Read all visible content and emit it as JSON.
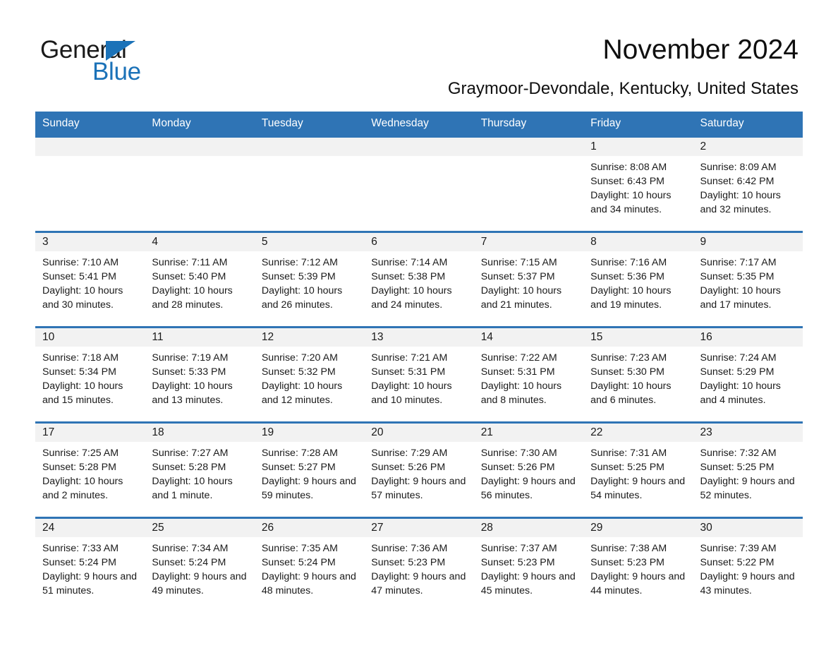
{
  "brand": {
    "name_part1": "General",
    "name_part2": "Blue",
    "colors": {
      "blue": "#1b72b8",
      "header_blue": "#2f74b5",
      "band_gray": "#f2f2f2"
    }
  },
  "header": {
    "title": "November 2024",
    "subtitle": "Graymoor-Devondale, Kentucky, United States"
  },
  "calendar": {
    "weekdays": [
      "Sunday",
      "Monday",
      "Tuesday",
      "Wednesday",
      "Thursday",
      "Friday",
      "Saturday"
    ],
    "weeks": [
      [
        {
          "day": "",
          "sunrise": "",
          "sunset": "",
          "daylight": ""
        },
        {
          "day": "",
          "sunrise": "",
          "sunset": "",
          "daylight": ""
        },
        {
          "day": "",
          "sunrise": "",
          "sunset": "",
          "daylight": ""
        },
        {
          "day": "",
          "sunrise": "",
          "sunset": "",
          "daylight": ""
        },
        {
          "day": "",
          "sunrise": "",
          "sunset": "",
          "daylight": ""
        },
        {
          "day": "1",
          "sunrise": "Sunrise: 8:08 AM",
          "sunset": "Sunset: 6:43 PM",
          "daylight": "Daylight: 10 hours and 34 minutes."
        },
        {
          "day": "2",
          "sunrise": "Sunrise: 8:09 AM",
          "sunset": "Sunset: 6:42 PM",
          "daylight": "Daylight: 10 hours and 32 minutes."
        }
      ],
      [
        {
          "day": "3",
          "sunrise": "Sunrise: 7:10 AM",
          "sunset": "Sunset: 5:41 PM",
          "daylight": "Daylight: 10 hours and 30 minutes."
        },
        {
          "day": "4",
          "sunrise": "Sunrise: 7:11 AM",
          "sunset": "Sunset: 5:40 PM",
          "daylight": "Daylight: 10 hours and 28 minutes."
        },
        {
          "day": "5",
          "sunrise": "Sunrise: 7:12 AM",
          "sunset": "Sunset: 5:39 PM",
          "daylight": "Daylight: 10 hours and 26 minutes."
        },
        {
          "day": "6",
          "sunrise": "Sunrise: 7:14 AM",
          "sunset": "Sunset: 5:38 PM",
          "daylight": "Daylight: 10 hours and 24 minutes."
        },
        {
          "day": "7",
          "sunrise": "Sunrise: 7:15 AM",
          "sunset": "Sunset: 5:37 PM",
          "daylight": "Daylight: 10 hours and 21 minutes."
        },
        {
          "day": "8",
          "sunrise": "Sunrise: 7:16 AM",
          "sunset": "Sunset: 5:36 PM",
          "daylight": "Daylight: 10 hours and 19 minutes."
        },
        {
          "day": "9",
          "sunrise": "Sunrise: 7:17 AM",
          "sunset": "Sunset: 5:35 PM",
          "daylight": "Daylight: 10 hours and 17 minutes."
        }
      ],
      [
        {
          "day": "10",
          "sunrise": "Sunrise: 7:18 AM",
          "sunset": "Sunset: 5:34 PM",
          "daylight": "Daylight: 10 hours and 15 minutes."
        },
        {
          "day": "11",
          "sunrise": "Sunrise: 7:19 AM",
          "sunset": "Sunset: 5:33 PM",
          "daylight": "Daylight: 10 hours and 13 minutes."
        },
        {
          "day": "12",
          "sunrise": "Sunrise: 7:20 AM",
          "sunset": "Sunset: 5:32 PM",
          "daylight": "Daylight: 10 hours and 12 minutes."
        },
        {
          "day": "13",
          "sunrise": "Sunrise: 7:21 AM",
          "sunset": "Sunset: 5:31 PM",
          "daylight": "Daylight: 10 hours and 10 minutes."
        },
        {
          "day": "14",
          "sunrise": "Sunrise: 7:22 AM",
          "sunset": "Sunset: 5:31 PM",
          "daylight": "Daylight: 10 hours and 8 minutes."
        },
        {
          "day": "15",
          "sunrise": "Sunrise: 7:23 AM",
          "sunset": "Sunset: 5:30 PM",
          "daylight": "Daylight: 10 hours and 6 minutes."
        },
        {
          "day": "16",
          "sunrise": "Sunrise: 7:24 AM",
          "sunset": "Sunset: 5:29 PM",
          "daylight": "Daylight: 10 hours and 4 minutes."
        }
      ],
      [
        {
          "day": "17",
          "sunrise": "Sunrise: 7:25 AM",
          "sunset": "Sunset: 5:28 PM",
          "daylight": "Daylight: 10 hours and 2 minutes."
        },
        {
          "day": "18",
          "sunrise": "Sunrise: 7:27 AM",
          "sunset": "Sunset: 5:28 PM",
          "daylight": "Daylight: 10 hours and 1 minute."
        },
        {
          "day": "19",
          "sunrise": "Sunrise: 7:28 AM",
          "sunset": "Sunset: 5:27 PM",
          "daylight": "Daylight: 9 hours and 59 minutes."
        },
        {
          "day": "20",
          "sunrise": "Sunrise: 7:29 AM",
          "sunset": "Sunset: 5:26 PM",
          "daylight": "Daylight: 9 hours and 57 minutes."
        },
        {
          "day": "21",
          "sunrise": "Sunrise: 7:30 AM",
          "sunset": "Sunset: 5:26 PM",
          "daylight": "Daylight: 9 hours and 56 minutes."
        },
        {
          "day": "22",
          "sunrise": "Sunrise: 7:31 AM",
          "sunset": "Sunset: 5:25 PM",
          "daylight": "Daylight: 9 hours and 54 minutes."
        },
        {
          "day": "23",
          "sunrise": "Sunrise: 7:32 AM",
          "sunset": "Sunset: 5:25 PM",
          "daylight": "Daylight: 9 hours and 52 minutes."
        }
      ],
      [
        {
          "day": "24",
          "sunrise": "Sunrise: 7:33 AM",
          "sunset": "Sunset: 5:24 PM",
          "daylight": "Daylight: 9 hours and 51 minutes."
        },
        {
          "day": "25",
          "sunrise": "Sunrise: 7:34 AM",
          "sunset": "Sunset: 5:24 PM",
          "daylight": "Daylight: 9 hours and 49 minutes."
        },
        {
          "day": "26",
          "sunrise": "Sunrise: 7:35 AM",
          "sunset": "Sunset: 5:24 PM",
          "daylight": "Daylight: 9 hours and 48 minutes."
        },
        {
          "day": "27",
          "sunrise": "Sunrise: 7:36 AM",
          "sunset": "Sunset: 5:23 PM",
          "daylight": "Daylight: 9 hours and 47 minutes."
        },
        {
          "day": "28",
          "sunrise": "Sunrise: 7:37 AM",
          "sunset": "Sunset: 5:23 PM",
          "daylight": "Daylight: 9 hours and 45 minutes."
        },
        {
          "day": "29",
          "sunrise": "Sunrise: 7:38 AM",
          "sunset": "Sunset: 5:23 PM",
          "daylight": "Daylight: 9 hours and 44 minutes."
        },
        {
          "day": "30",
          "sunrise": "Sunrise: 7:39 AM",
          "sunset": "Sunset: 5:22 PM",
          "daylight": "Daylight: 9 hours and 43 minutes."
        }
      ]
    ]
  }
}
